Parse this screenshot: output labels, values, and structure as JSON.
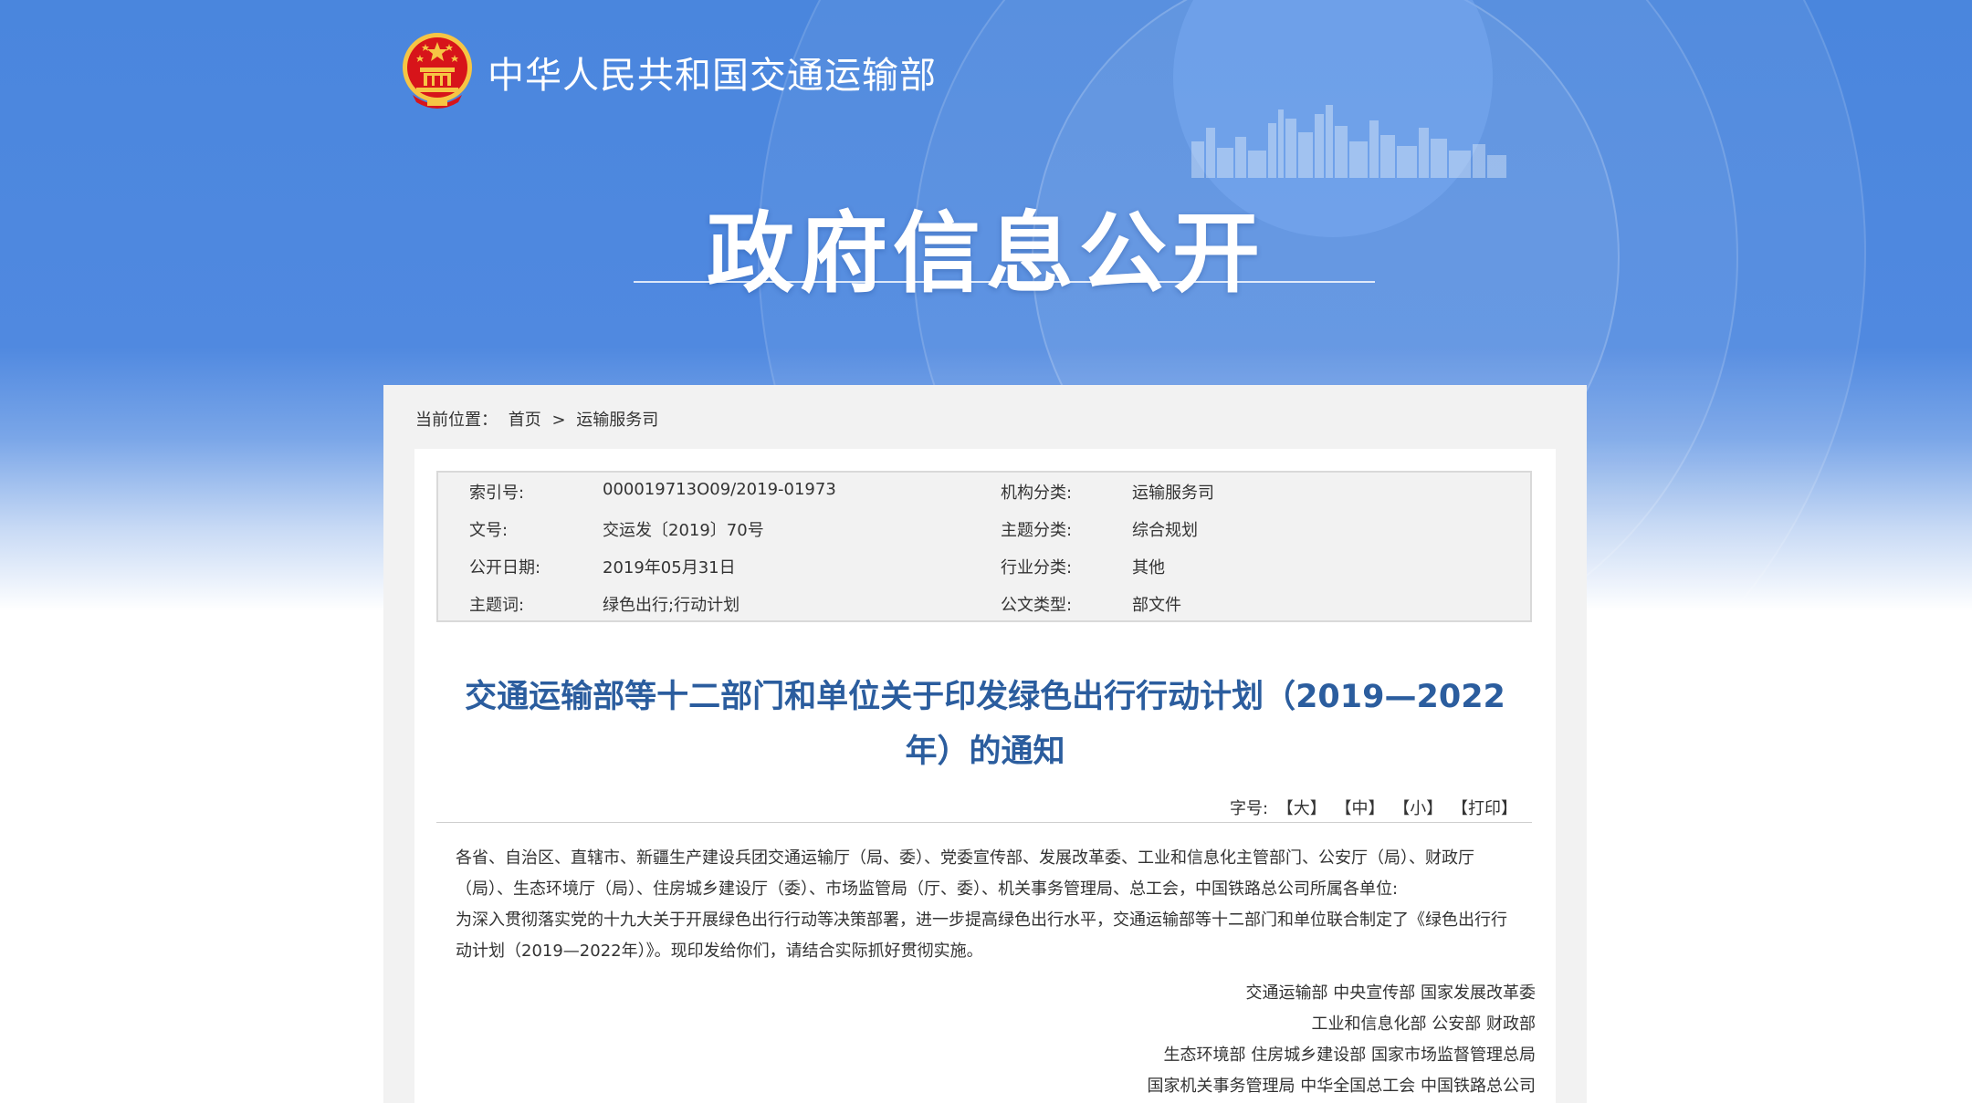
{
  "header": {
    "site_title": "中华人民共和国交通运输部",
    "hero_title": "政府信息公开"
  },
  "breadcrumb": {
    "label": "当前位置：",
    "home": "首页",
    "separator": ">",
    "current": "运输服务司"
  },
  "meta": {
    "rows": [
      {
        "k1": "索引号:",
        "v1": "000019713O09/2019-01973",
        "k2": "机构分类:",
        "v2": "运输服务司"
      },
      {
        "k1": "文号:",
        "v1": "交运发〔2019〕70号",
        "k2": "主题分类:",
        "v2": "综合规划"
      },
      {
        "k1": "公开日期:",
        "v1": "2019年05月31日",
        "k2": "行业分类:",
        "v2": "其他"
      },
      {
        "k1": "主题词:",
        "v1": "绿色出行;行动计划",
        "k2": "公文类型:",
        "v2": "部文件"
      }
    ]
  },
  "document": {
    "title_line1": "交通运输部等十二部门和单位关于印发绿色出行行动计划（2019—2022",
    "title_line2": "年）的通知",
    "font_size_label": "字号:",
    "font_options": [
      "【大】",
      "【中】",
      "【小】",
      "【打印】"
    ],
    "paragraph1": "各省、自治区、直辖市、新疆生产建设兵团交通运输厅（局、委）、党委宣传部、发展改革委、工业和信息化主管部门、公安厅（局）、财政厅（局）、生态环境厅（局）、住房城乡建设厅（委）、市场监管局（厅、委）、机关事务管理局、总工会，中国铁路总公司所属各单位:",
    "paragraph2": "为深入贯彻落实党的十九大关于开展绿色出行行动等决策部署，进一步提高绿色出行水平，交通运输部等十二部门和单位联合制定了《绿色出行行动计划（2019—2022年）》。现印发给你们，请结合实际抓好贯彻实施。",
    "signers": [
      "交通运输部 中央宣传部 国家发展改革委",
      "工业和信息化部 公安部 财政部",
      "生态环境部 住房城乡建设部 国家市场监督管理总局",
      "国家机关事务管理局 中华全国总工会 中国铁路总公司"
    ]
  },
  "colors": {
    "banner_blue": "#4a86dd",
    "title_blue": "#2b5d9e",
    "emblem_red": "#d7141a",
    "emblem_gold": "#f6c544"
  },
  "icons": {
    "logo": "national-emblem-icon"
  }
}
